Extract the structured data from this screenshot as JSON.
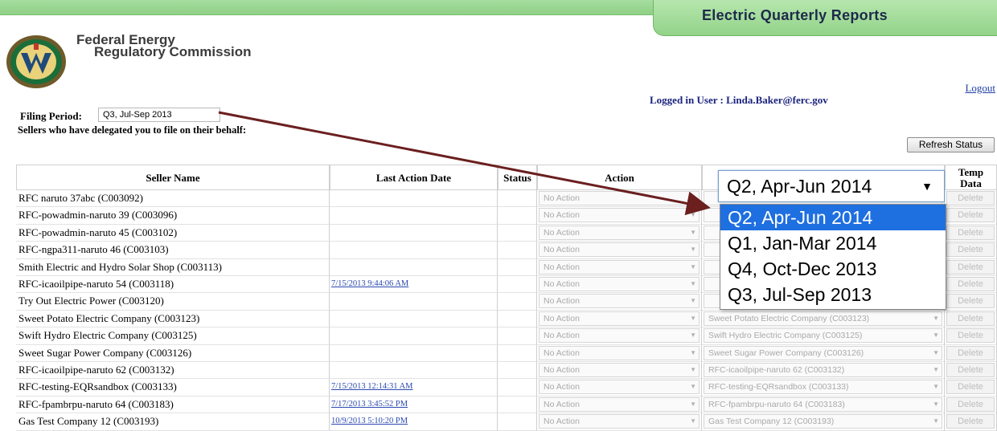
{
  "app": {
    "title": "Electric Quarterly Reports"
  },
  "agency": {
    "line1": "Federal Energy",
    "line2": "Regulatory Commission"
  },
  "header": {
    "logout": "Logout",
    "logged_user_label": "Logged in User :",
    "logged_user_email": "Linda.Baker@ferc.gov"
  },
  "filing": {
    "label": "Filing Period:",
    "value": "Q3, Jul-Sep 2013",
    "note": "Sellers who have delegated you to file on their behalf:"
  },
  "refresh_label": "Refresh Status",
  "table": {
    "headers": {
      "seller": "Seller Name",
      "date": "Last Action Date",
      "status": "Status",
      "action": "Action",
      "temp1": "Temp",
      "temp2": "Data"
    },
    "action_default": "No Action",
    "delete_label": "Delete",
    "rows": [
      {
        "name": "RFC naruto 37abc (C003092)",
        "date": "",
        "seller_select": ""
      },
      {
        "name": "RFC-powadmin-naruto 39 (C003096)",
        "date": "",
        "seller_select": ""
      },
      {
        "name": "RFC-powadmin-naruto 45 (C003102)",
        "date": "",
        "seller_select": ""
      },
      {
        "name": "RFC-ngpa311-naruto 46 (C003103)",
        "date": "",
        "seller_select": ""
      },
      {
        "name": "Smith Electric and Hydro Solar Shop (C003113)",
        "date": "",
        "seller_select": ""
      },
      {
        "name": "RFC-icaoilpipe-naruto 54 (C003118)",
        "date": "7/15/2013 9:44:06 AM",
        "seller_select": ""
      },
      {
        "name": "Try Out Electric Power (C003120)",
        "date": "",
        "seller_select": ""
      },
      {
        "name": "Sweet Potato Electric Company (C003123)",
        "date": "",
        "seller_select": "Sweet Potato Electric Company (C003123)"
      },
      {
        "name": "Swift Hydro Electric Company (C003125)",
        "date": "",
        "seller_select": "Swift Hydro Electric Company (C003125)"
      },
      {
        "name": "Sweet Sugar Power Company (C003126)",
        "date": "",
        "seller_select": "Sweet Sugar Power Company (C003126)"
      },
      {
        "name": "RFC-icaoilpipe-naruto 62 (C003132)",
        "date": "",
        "seller_select": "RFC-icaoilpipe-naruto 62 (C003132)"
      },
      {
        "name": "RFC-testing-EQRsandbox (C003133)",
        "date": "7/15/2013 12:14:31 AM",
        "seller_select": "RFC-testing-EQRsandbox (C003133)"
      },
      {
        "name": "RFC-fpambrpu-naruto 64 (C003183)",
        "date": "7/17/2013 3:45:52 PM",
        "seller_select": "RFC-fpambrpu-naruto 64 (C003183)"
      },
      {
        "name": "Gas Test Company 12 (C003193)",
        "date": "10/9/2013 5:10:20 PM",
        "seller_select": "Gas Test Company 12 (C003193)"
      }
    ]
  },
  "period_dropdown": {
    "selected": "Q2, Apr-Jun 2014",
    "options": [
      "Q2, Apr-Jun 2014",
      "Q1, Jan-Mar 2014",
      "Q4, Oct-Dec 2013",
      "Q3, Jul-Sep 2013"
    ]
  },
  "colors": {
    "header_green": "#9ed795",
    "callout_arrow": "#6b1f1f",
    "highlight_blue": "#1e6fe0",
    "user_text": "#1a237e"
  }
}
